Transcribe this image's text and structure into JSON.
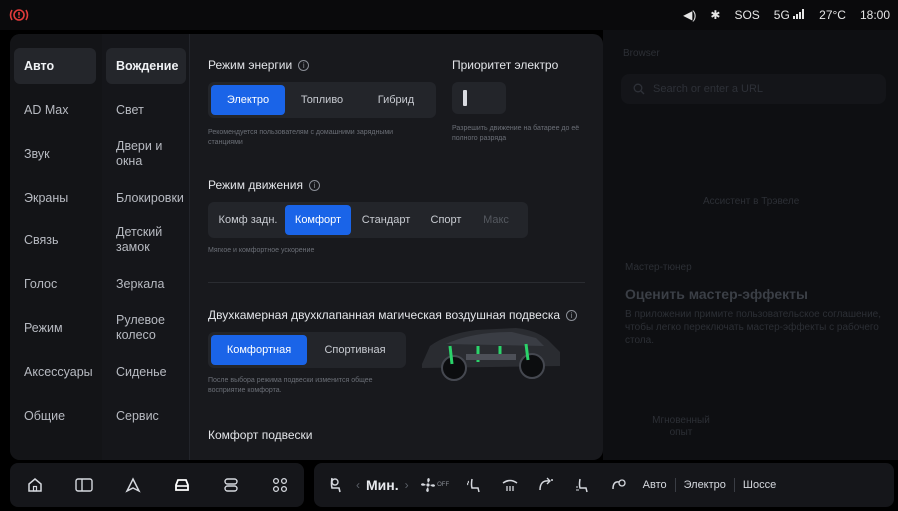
{
  "status": {
    "volume": "◀)",
    "bluetooth": "✱",
    "sos": "SOS",
    "network": "5G",
    "temperature": "27°C",
    "time": "18:00"
  },
  "background": {
    "browser_title": "Browser",
    "search_placeholder": "Search or enter a URL",
    "assistant_text": "Ассистент в Трэвеле",
    "tuner_label": "Мастер-тюнер",
    "tuner_title": "Оценить мастер-эффекты",
    "tuner_desc": "В приложении примите пользовательское соглашение, чтобы легко переключать мастер-эффекты с рабочего стола.",
    "instant_label": "Мгновенный опыт"
  },
  "categories": [
    {
      "label": "Авто",
      "active": true
    },
    {
      "label": "AD Max"
    },
    {
      "label": "Звук"
    },
    {
      "label": "Экраны"
    },
    {
      "label": "Связь"
    },
    {
      "label": "Голос"
    },
    {
      "label": "Режим"
    },
    {
      "label": "Аксессуары"
    },
    {
      "label": "Общие"
    }
  ],
  "subcategories": [
    {
      "label": "Вождение",
      "active": true
    },
    {
      "label": "Свет"
    },
    {
      "label": "Двери и окна"
    },
    {
      "label": "Блокировки"
    },
    {
      "label": "Детский замок"
    },
    {
      "label": "Зеркала"
    },
    {
      "label": "Рулевое колесо"
    },
    {
      "label": "Сиденье"
    },
    {
      "label": "Сервис"
    }
  ],
  "energy": {
    "title": "Режим энергии",
    "options": [
      "Электро",
      "Топливо",
      "Гибрид"
    ],
    "selected": "Электро",
    "hint": "Рекомендуется пользователям с домашними зарядными станциями"
  },
  "priority": {
    "title": "Приоритет электро",
    "hint": "Разрешить движение на батарее до её полного разряда"
  },
  "drive": {
    "title": "Режим движения",
    "options": [
      "Комф задн.",
      "Комфорт",
      "Стандарт",
      "Спорт",
      "Макс"
    ],
    "selected": "Комфорт",
    "disabled": "Макс",
    "hint": "Мягкое и комфортное ускорение"
  },
  "suspension": {
    "title": "Двухкамерная двухклапанная магическая воздушная подвеска",
    "options": [
      "Комфортная",
      "Спортивная"
    ],
    "selected": "Комфортная",
    "hint": "После выбора режима подвески изменится общее восприятие комфорта."
  },
  "comfort_title": "Комфорт подвески",
  "dock": {
    "fan_value": "Мин.",
    "fan_left": "‹",
    "fan_right": "›",
    "off_label": "OFF",
    "modes": [
      "Авто",
      "Электро",
      "Шоссе"
    ]
  },
  "colors": {
    "accent": "#1a64e8",
    "alert": "#e23b3b",
    "suspension_glow": "#2bd36a"
  }
}
